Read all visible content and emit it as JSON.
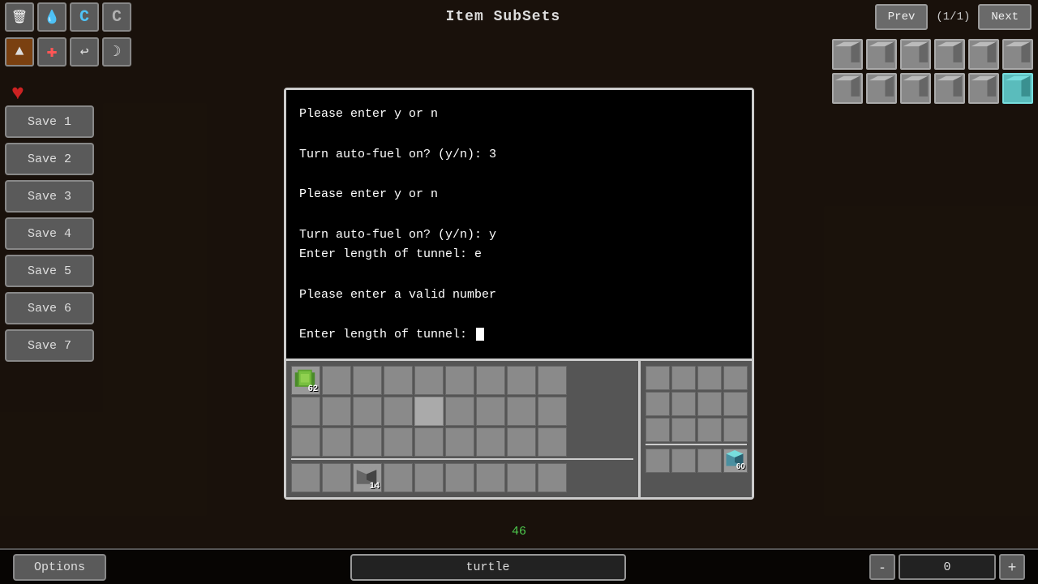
{
  "header": {
    "title": "Item SubSets",
    "prev_label": "Prev",
    "next_label": "Next",
    "page_indicator": "(1/1)"
  },
  "toolbar": {
    "row1_icons": [
      "🗑",
      "💧",
      "C",
      "C"
    ],
    "row2_icons": [
      "▲",
      "✚",
      "↩",
      "☽"
    ],
    "heart_icon": "♥"
  },
  "sidebar": {
    "save_buttons": [
      "Save 1",
      "Save 2",
      "Save 3",
      "Save 4",
      "Save 5",
      "Save 6",
      "Save 7"
    ]
  },
  "terminal": {
    "lines": [
      "Please enter y or n",
      "",
      "Turn auto-fuel on? (y/n): 3",
      "",
      "Please enter y or n",
      "",
      "Turn auto-fuel on? (y/n): y",
      "Enter length of tunnel: e",
      "",
      "Please enter a valid number",
      "",
      "Enter length of tunnel: _"
    ]
  },
  "inventory": {
    "slot1_count": "62",
    "slot2_count": "14",
    "slot3_count": "60"
  },
  "bottom": {
    "options_label": "Options",
    "search_value": "turtle",
    "stepper_minus": "-",
    "stepper_value": "0",
    "stepper_plus": "+"
  },
  "center_number": "46"
}
